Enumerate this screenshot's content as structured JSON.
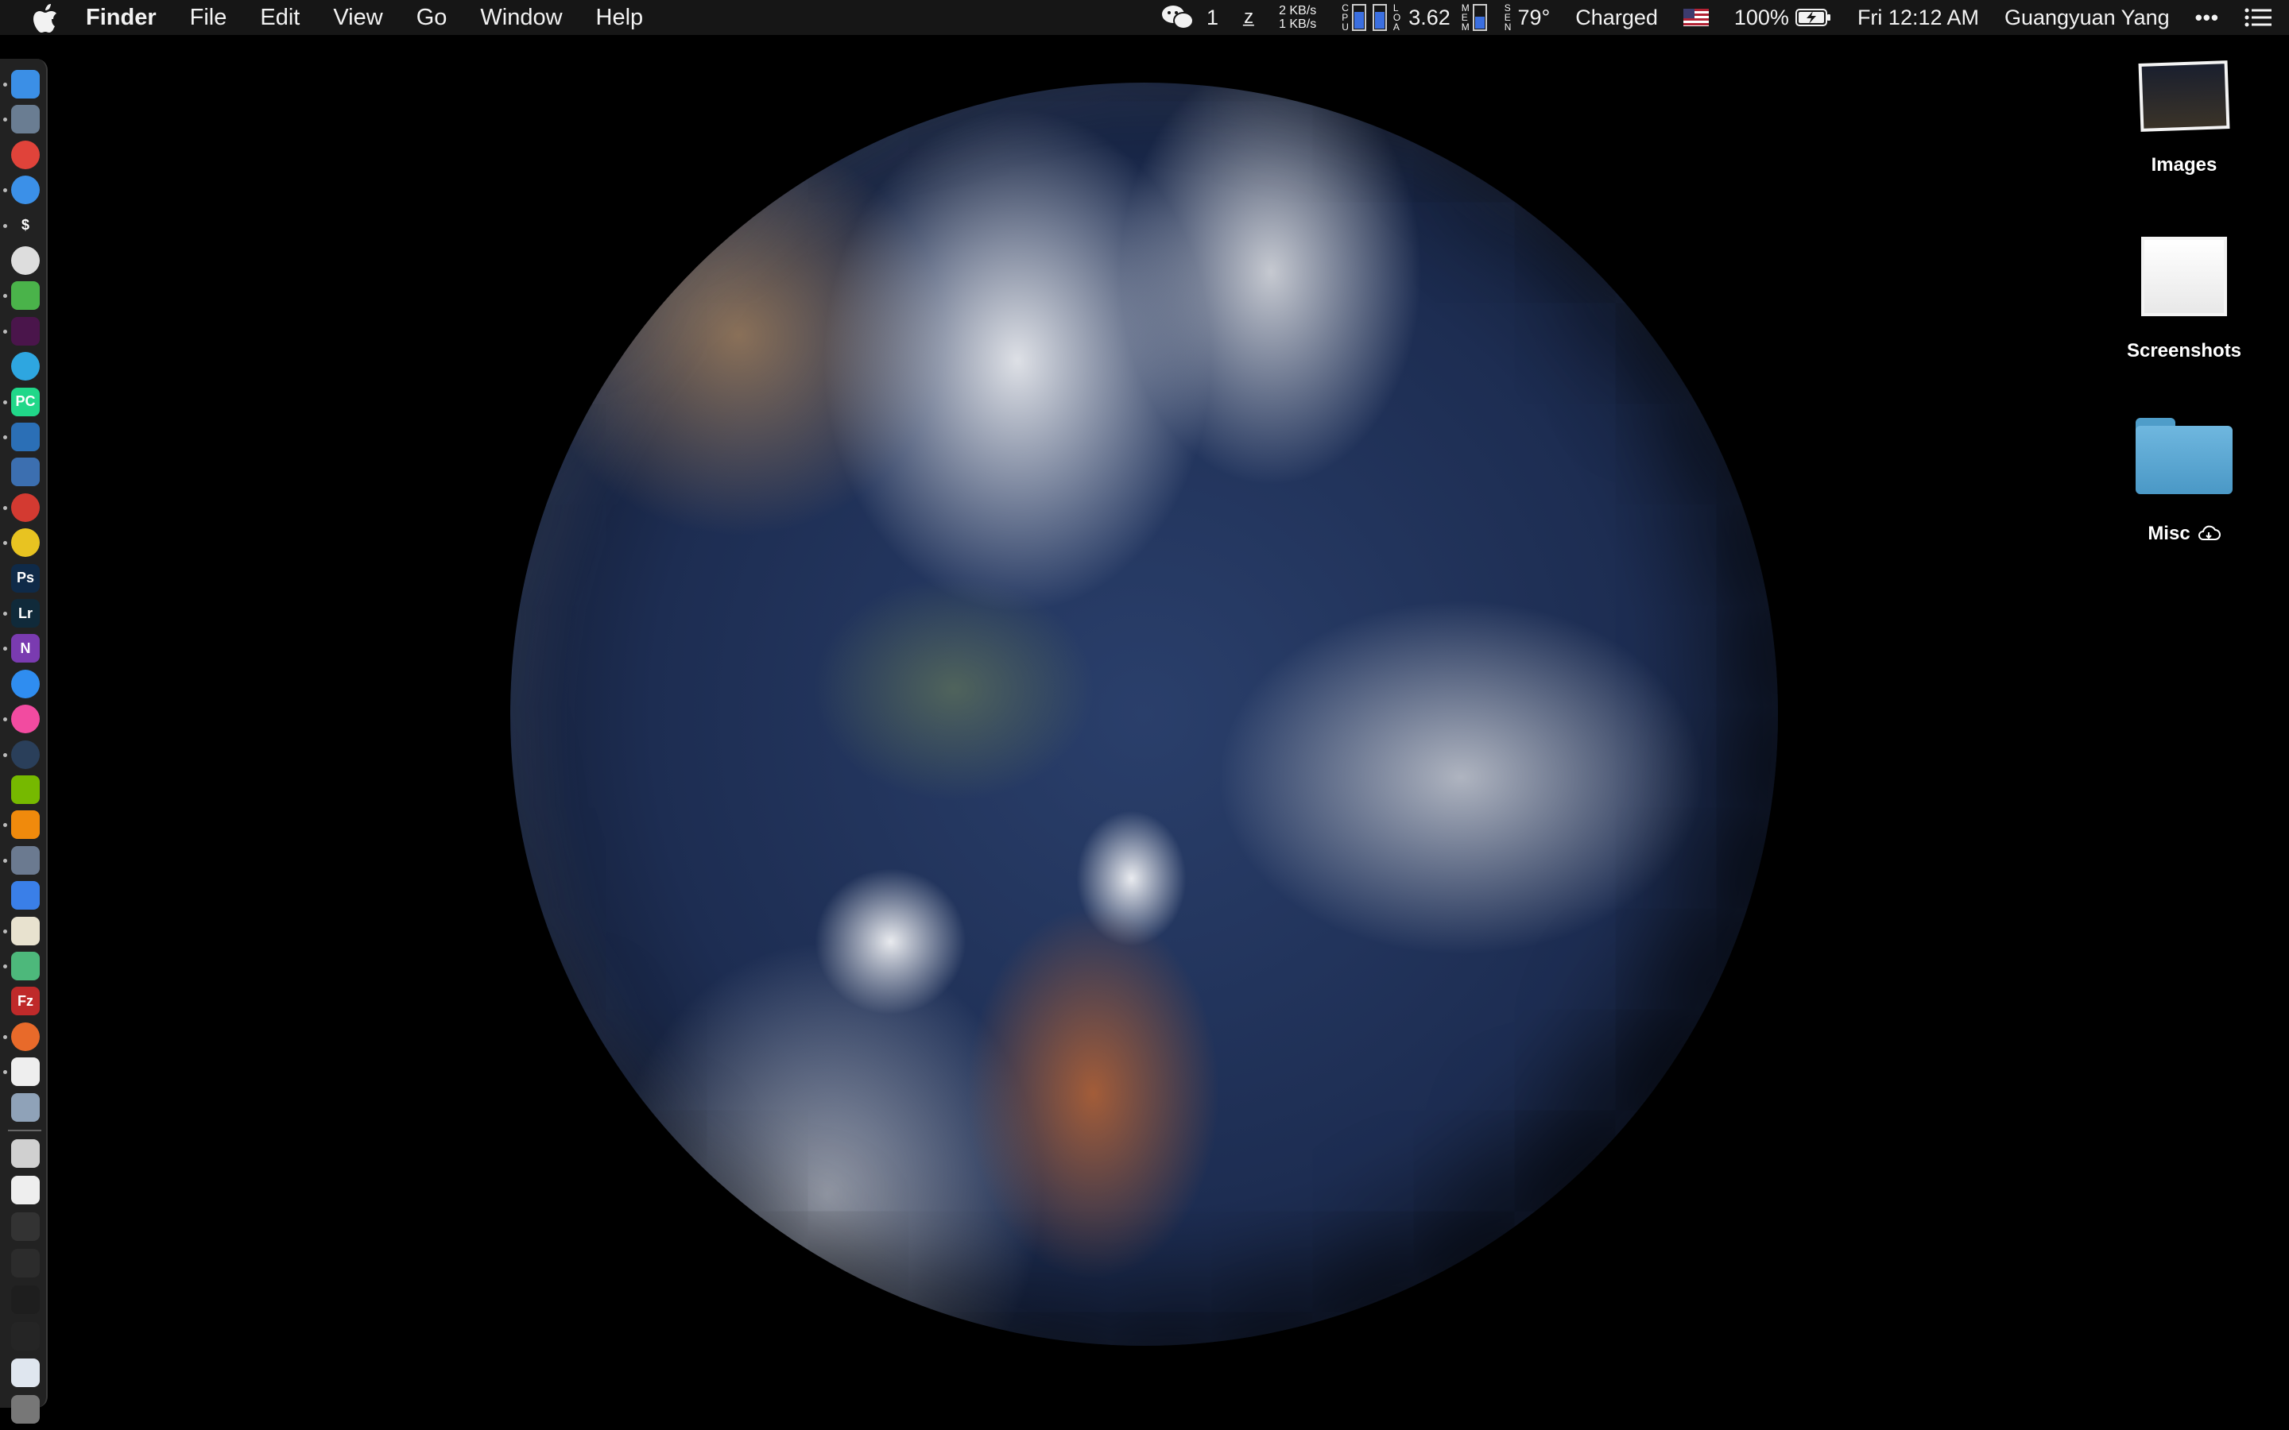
{
  "menubar": {
    "app_name": "Finder",
    "menus": [
      "File",
      "Edit",
      "View",
      "Go",
      "Window",
      "Help"
    ],
    "status": {
      "wechat_count": "1",
      "net_up": "2 KB/s",
      "net_down": "1 KB/s",
      "cpu_label": [
        "C",
        "P",
        "U"
      ],
      "load_label": [
        "L",
        "O",
        "A"
      ],
      "load_value": "3.62",
      "mem_label": [
        "M",
        "E",
        "M"
      ],
      "sen_label": [
        "S",
        "E",
        "N"
      ],
      "temperature": "79°",
      "power_status": "Charged",
      "battery_percent": "100%",
      "datetime": "Fri 12:12 AM",
      "user": "Guangyuan Yang",
      "cpu_fill": 0.7,
      "mem_fill": 0.5
    }
  },
  "dock": {
    "icons": [
      {
        "name": "finder-icon",
        "color": "#3b8fe6",
        "glyph": ""
      },
      {
        "name": "launchpad-icon",
        "color": "#6a7d92",
        "glyph": ""
      },
      {
        "name": "chrome-icon",
        "color": "#e0433a",
        "glyph": ""
      },
      {
        "name": "safari-icon",
        "color": "#3b90e8",
        "glyph": ""
      },
      {
        "name": "terminal-icon",
        "color": "#222222",
        "glyph": "$"
      },
      {
        "name": "qq-icon",
        "color": "#dddddd",
        "glyph": ""
      },
      {
        "name": "wechat-icon",
        "color": "#4ab34a",
        "glyph": ""
      },
      {
        "name": "slack-icon",
        "color": "#4a154b",
        "glyph": ""
      },
      {
        "name": "telegram-icon",
        "color": "#2ea6e0",
        "glyph": ""
      },
      {
        "name": "pycharm-icon",
        "color": "#21d789",
        "glyph": "PC"
      },
      {
        "name": "vscode-icon",
        "color": "#2b6fb6",
        "glyph": ""
      },
      {
        "name": "virtualbox-icon",
        "color": "#3c6fb0",
        "glyph": ""
      },
      {
        "name": "netease-music-icon",
        "color": "#d33a31",
        "glyph": ""
      },
      {
        "name": "yellow-app-icon",
        "color": "#e8c321",
        "glyph": ""
      },
      {
        "name": "photoshop-icon",
        "color": "#0f2a48",
        "glyph": "Ps"
      },
      {
        "name": "lightroom-icon",
        "color": "#102a3a",
        "glyph": "Lr"
      },
      {
        "name": "onenote-icon",
        "color": "#7a3bb0",
        "glyph": "N"
      },
      {
        "name": "app-store-icon",
        "color": "#2f8df0",
        "glyph": ""
      },
      {
        "name": "itunes-icon",
        "color": "#f24ba0",
        "glyph": ""
      },
      {
        "name": "steam-icon",
        "color": "#2a3f5a",
        "glyph": ""
      },
      {
        "name": "nvidia-icon",
        "color": "#76b900",
        "glyph": ""
      },
      {
        "name": "vlc-icon",
        "color": "#f08a0c",
        "glyph": ""
      },
      {
        "name": "automator-icon",
        "color": "#6b7a90",
        "glyph": ""
      },
      {
        "name": "baidu-netdisk-icon",
        "color": "#3a7fe8",
        "glyph": ""
      },
      {
        "name": "preview-icon",
        "color": "#e8e2cf",
        "glyph": ""
      },
      {
        "name": "maps-icon",
        "color": "#4db87b",
        "glyph": ""
      },
      {
        "name": "filezilla-icon",
        "color": "#bf2a2a",
        "glyph": "Fz"
      },
      {
        "name": "firefox-icon",
        "color": "#e86a2a",
        "glyph": ""
      },
      {
        "name": "textedit-icon",
        "color": "#eeeeee",
        "glyph": ""
      },
      {
        "name": "image-capture-icon",
        "color": "#8fa2b8",
        "glyph": ""
      },
      {
        "name": "printer-icon",
        "color": "#d0d0d0",
        "glyph": ""
      },
      {
        "name": "window-thumbnail-icon",
        "color": "#eeeeee",
        "glyph": ""
      },
      {
        "name": "window-thumbnail-icon",
        "color": "#333333",
        "glyph": ""
      },
      {
        "name": "window-thumbnail-icon",
        "color": "#2c2c2c",
        "glyph": ""
      },
      {
        "name": "window-thumbnail-icon",
        "color": "#1e1e1e",
        "glyph": ""
      },
      {
        "name": "window-thumbnail-icon",
        "color": "#252525",
        "glyph": ""
      },
      {
        "name": "downloads-stack-icon",
        "color": "#dfe6ef",
        "glyph": ""
      },
      {
        "name": "trash-icon",
        "color": "#777777",
        "glyph": ""
      }
    ]
  },
  "desktop": {
    "items": [
      {
        "label": "Images"
      },
      {
        "label": "Screenshots"
      },
      {
        "label": "Misc"
      }
    ]
  }
}
